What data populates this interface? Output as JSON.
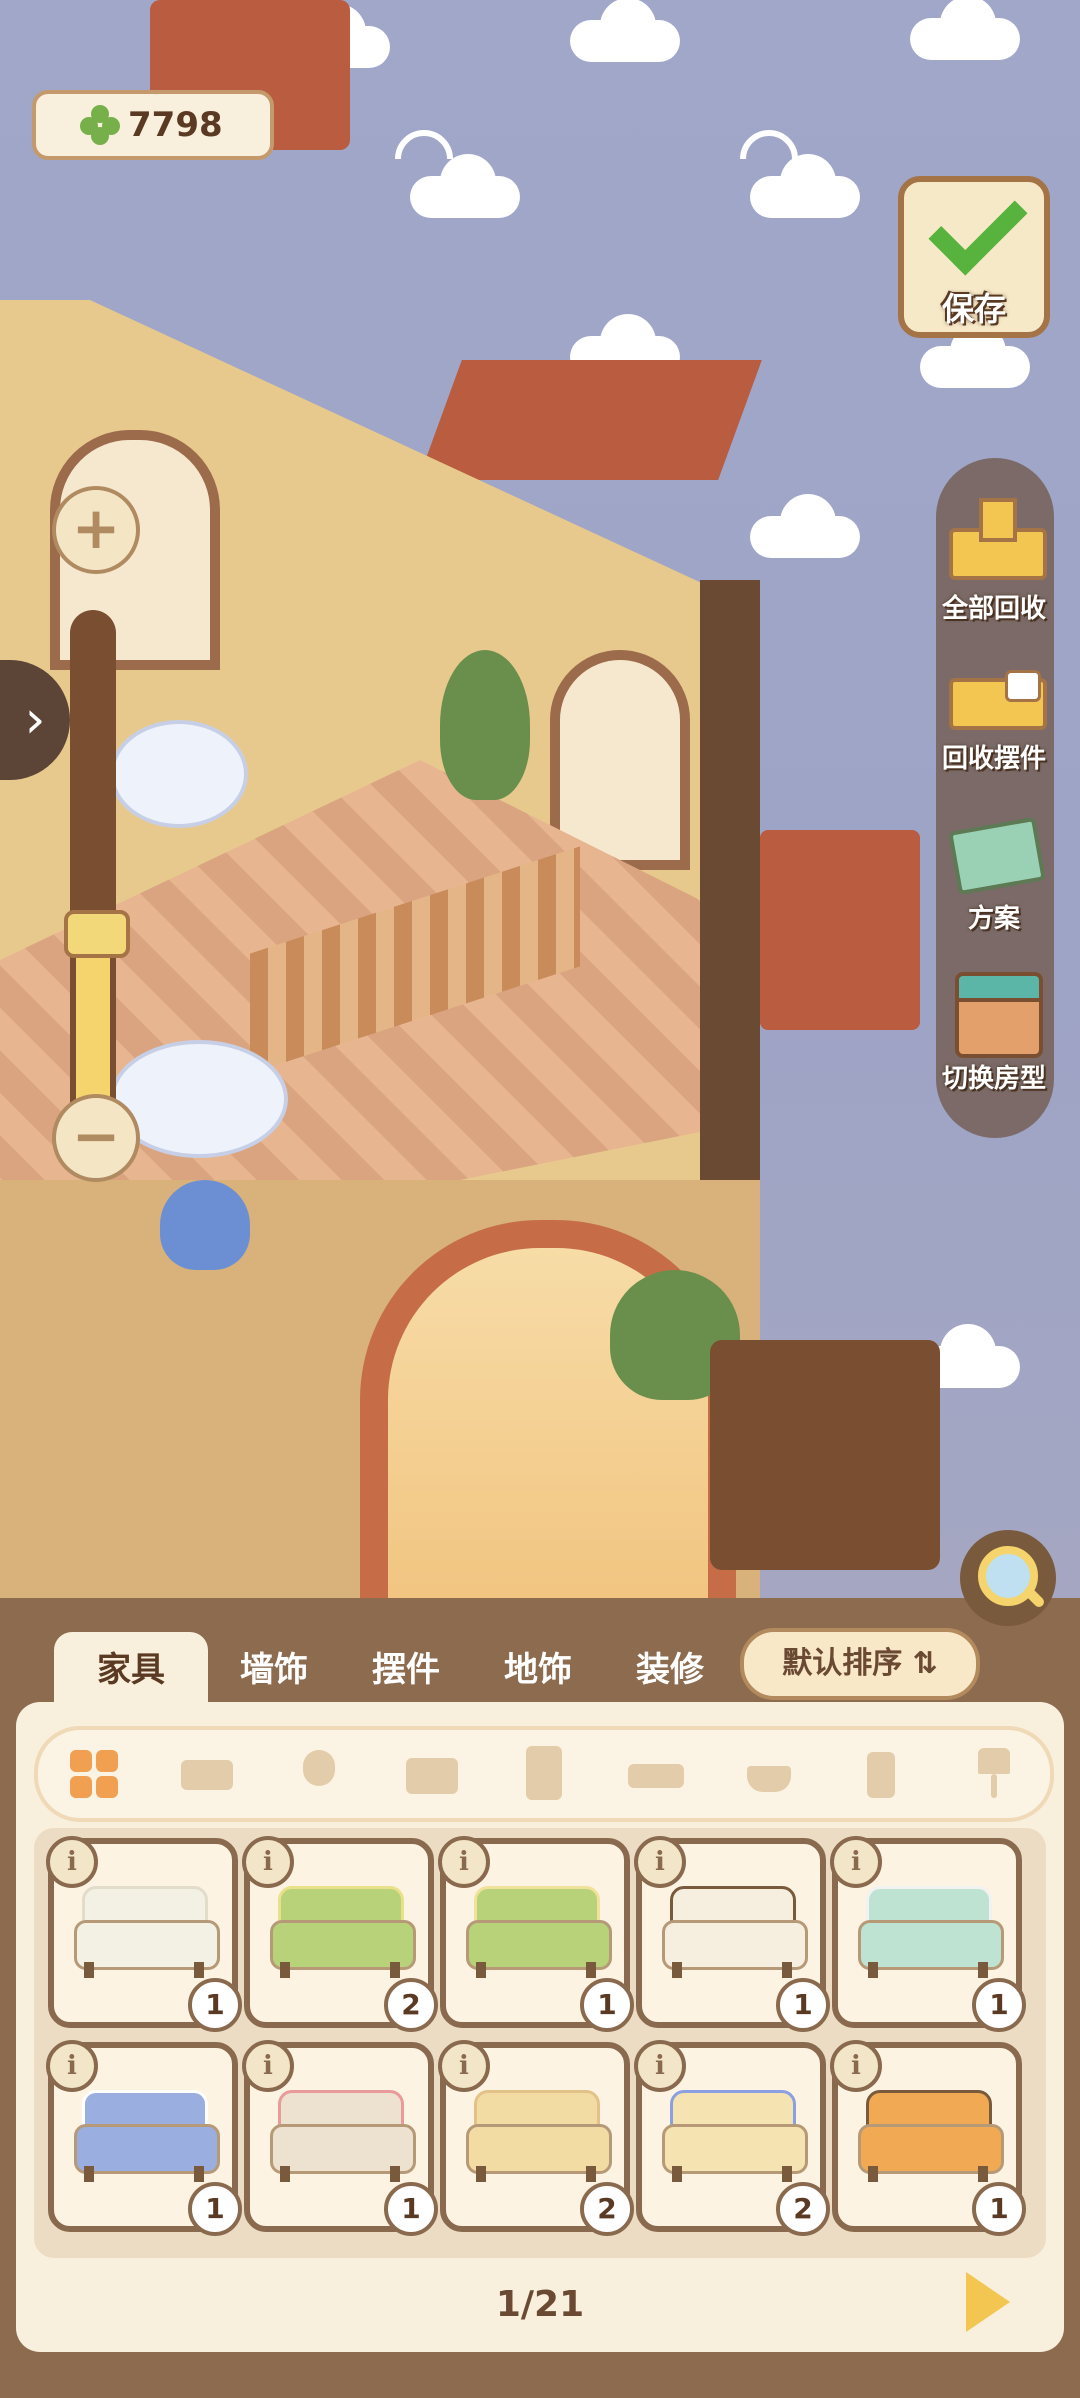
{
  "hud": {
    "currency_icon": "clover-icon",
    "currency_value": "7798",
    "save_label": "保存"
  },
  "side_menu": [
    {
      "label": "全部回收",
      "icon": "recycle-all-icon"
    },
    {
      "label": "回收摆件",
      "icon": "recycle-ornament-icon"
    },
    {
      "label": "方案",
      "icon": "blueprint-icon"
    },
    {
      "label": "切换房型",
      "icon": "switch-room-icon"
    }
  ],
  "tabs": [
    "家具",
    "墙饰",
    "摆件",
    "地饰",
    "装修"
  ],
  "active_tab": 0,
  "sort_label": "默认排序 ⇅",
  "filters": [
    "all-grid-icon",
    "sofa-icon",
    "chair-icon",
    "desk-icon",
    "cabinet-icon",
    "bed-icon",
    "stove-icon",
    "toilet-icon",
    "lamp-icon"
  ],
  "items": [
    {
      "name": "white-sofa",
      "count": "1",
      "color": "#f3f0e4",
      "accent": "#e2dccb"
    },
    {
      "name": "green-armchair",
      "count": "2",
      "color": "#b8d27a",
      "accent": "#e9e08a"
    },
    {
      "name": "green-sofa",
      "count": "1",
      "color": "#b8d27a",
      "accent": "#f0e29a"
    },
    {
      "name": "white-cushion-bed",
      "count": "1",
      "color": "#f6efe0",
      "accent": "#7a5a3c"
    },
    {
      "name": "mint-bench-sofa",
      "count": "1",
      "color": "#bfe3d2",
      "accent": "#f2f2f2"
    },
    {
      "name": "blue-sofa",
      "count": "1",
      "color": "#9aaee0",
      "accent": "#ffffff"
    },
    {
      "name": "beige-sofa-pink-pillows",
      "count": "1",
      "color": "#ece2cf",
      "accent": "#e99a9a"
    },
    {
      "name": "cream-chaise",
      "count": "2",
      "color": "#f3dca3",
      "accent": "#e3c28a"
    },
    {
      "name": "cream-sectional",
      "count": "2",
      "color": "#f5e4b2",
      "accent": "#8aa0e0"
    },
    {
      "name": "orange-armchair",
      "count": "1",
      "color": "#f2a953",
      "accent": "#7a5a3c"
    }
  ],
  "pager": "1/21",
  "colors": {
    "panel": "#8c6b4e",
    "card_border": "#8a6a4e",
    "accent_yellow": "#f2c650"
  }
}
